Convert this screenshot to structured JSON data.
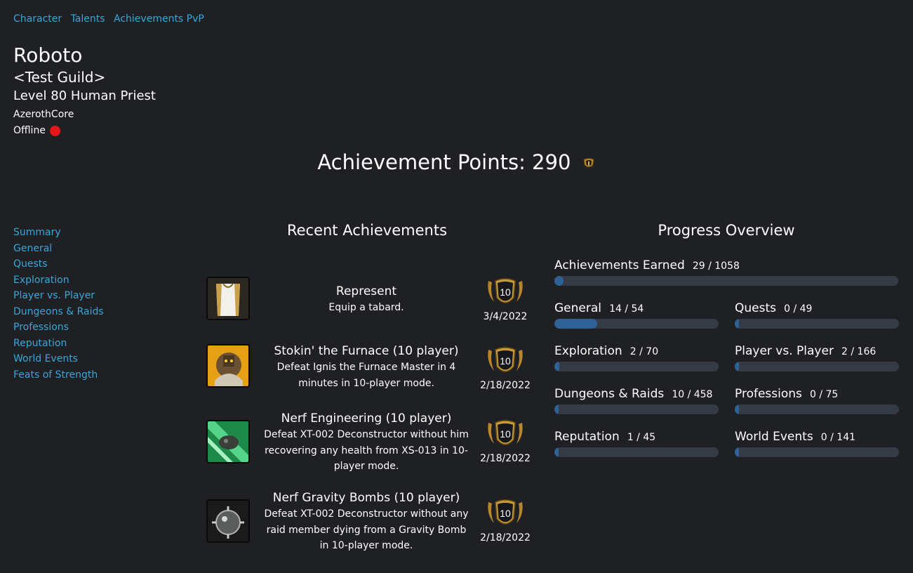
{
  "topnav": [
    "Character",
    "Talents",
    "Achievements PvP"
  ],
  "character": {
    "name": "Roboto",
    "guild": "<Test Guild>",
    "level_race_class": "Level 80 Human Priest",
    "realm": "AzerothCore",
    "status": "Offline",
    "status_color": "#e4151b"
  },
  "points": {
    "label": "Achievement Points: 290"
  },
  "sidenav": [
    "Summary",
    "General",
    "Quests",
    "Exploration",
    "Player vs. Player",
    "Dungeons & Raids",
    "Professions",
    "Reputation",
    "World Events",
    "Feats of Strength"
  ],
  "recent": {
    "title": "Recent Achievements",
    "items": [
      {
        "title": "Represent",
        "desc": "Equip a tabard.",
        "points": "10",
        "date": "3/4/2022",
        "icon": "tabard-icon"
      },
      {
        "title": "Stokin' the Furnace (10 player)",
        "desc": "Defeat Ignis the Furnace Master in 4 minutes in 10-player mode.",
        "points": "10",
        "date": "2/18/2022",
        "icon": "ignis-icon"
      },
      {
        "title": "Nerf Engineering (10 player)",
        "desc": "Defeat XT-002 Deconstructor without him recovering any health from XS-013 in 10-player mode.",
        "points": "10",
        "date": "2/18/2022",
        "icon": "engineering-icon"
      },
      {
        "title": "Nerf Gravity Bombs (10 player)",
        "desc": "Defeat XT-002 Deconstructor without any raid member dying from a Gravity Bomb in 10-player mode.",
        "points": "10",
        "date": "2/18/2022",
        "icon": "gravity-bomb-icon"
      }
    ]
  },
  "progress": {
    "title": "Progress Overview",
    "bar_color": "#2e6195",
    "track_color": "#353b45",
    "overall": {
      "label": "Achievements Earned",
      "count": "29 / 1058",
      "fraction": 0.0274
    },
    "categories": [
      {
        "label": "General",
        "count": "14 / 54",
        "fraction": 0.259
      },
      {
        "label": "Quests",
        "count": "0 / 49",
        "fraction": 0.0
      },
      {
        "label": "Exploration",
        "count": "2 / 70",
        "fraction": 0.0286
      },
      {
        "label": "Player vs. Player",
        "count": "2 / 166",
        "fraction": 0.012
      },
      {
        "label": "Dungeons & Raids",
        "count": "10 / 458",
        "fraction": 0.0218
      },
      {
        "label": "Professions",
        "count": "0 / 75",
        "fraction": 0.0
      },
      {
        "label": "Reputation",
        "count": "1 / 45",
        "fraction": 0.0222
      },
      {
        "label": "World Events",
        "count": "0 / 141",
        "fraction": 0.0
      }
    ]
  }
}
